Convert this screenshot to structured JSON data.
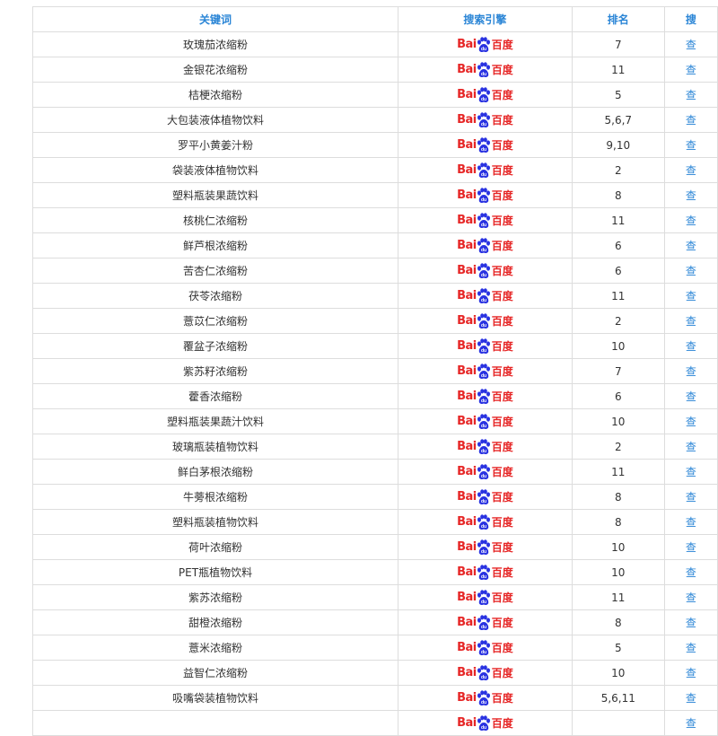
{
  "table": {
    "headers": [
      "关键词",
      "搜索引擎",
      "排名",
      "搜"
    ],
    "logo": {
      "latin": "Bai",
      "chinese": "百度",
      "color": "#e62626"
    },
    "header_color": "#2a85d6",
    "partial_cell_text": "查",
    "rows": [
      {
        "keyword": "玫瑰茄浓缩粉",
        "rank": "7"
      },
      {
        "keyword": "金银花浓缩粉",
        "rank": "11"
      },
      {
        "keyword": "桔梗浓缩粉",
        "rank": "5"
      },
      {
        "keyword": "大包装液体植物饮料",
        "rank": "5,6,7"
      },
      {
        "keyword": "罗平小黄姜汁粉",
        "rank": "9,10"
      },
      {
        "keyword": "袋装液体植物饮料",
        "rank": "2"
      },
      {
        "keyword": "塑料瓶装果蔬饮料",
        "rank": "8"
      },
      {
        "keyword": "核桃仁浓缩粉",
        "rank": "11"
      },
      {
        "keyword": "鲜芦根浓缩粉",
        "rank": "6"
      },
      {
        "keyword": "苦杏仁浓缩粉",
        "rank": "6"
      },
      {
        "keyword": "茯苓浓缩粉",
        "rank": "11"
      },
      {
        "keyword": "薏苡仁浓缩粉",
        "rank": "2"
      },
      {
        "keyword": "覆盆子浓缩粉",
        "rank": "10"
      },
      {
        "keyword": "紫苏籽浓缩粉",
        "rank": "7"
      },
      {
        "keyword": "藿香浓缩粉",
        "rank": "6"
      },
      {
        "keyword": "塑料瓶装果蔬汁饮料",
        "rank": "10"
      },
      {
        "keyword": "玻璃瓶装植物饮料",
        "rank": "2"
      },
      {
        "keyword": "鲜白茅根浓缩粉",
        "rank": "11"
      },
      {
        "keyword": "牛蒡根浓缩粉",
        "rank": "8"
      },
      {
        "keyword": "塑料瓶装植物饮料",
        "rank": "8"
      },
      {
        "keyword": "荷叶浓缩粉",
        "rank": "10"
      },
      {
        "keyword": "PET瓶植物饮料",
        "rank": "10"
      },
      {
        "keyword": "紫苏浓缩粉",
        "rank": "11"
      },
      {
        "keyword": "甜橙浓缩粉",
        "rank": "8"
      },
      {
        "keyword": "薏米浓缩粉",
        "rank": "5"
      },
      {
        "keyword": "益智仁浓缩粉",
        "rank": "10"
      },
      {
        "keyword": "吸嘴袋装植物饮料",
        "rank": "5,6,11"
      },
      {
        "keyword": "",
        "rank": ""
      }
    ]
  }
}
